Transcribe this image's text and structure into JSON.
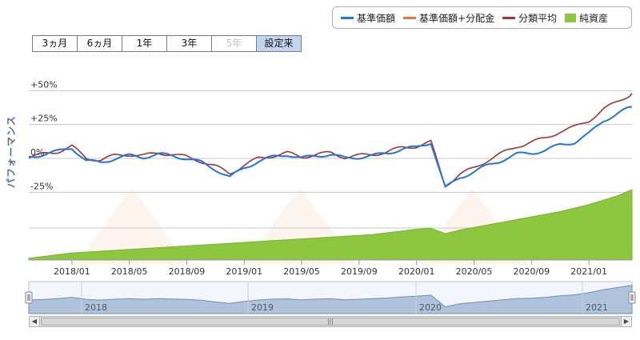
{
  "legend": {
    "items": [
      {
        "label": "基準価額",
        "color": "#1f77e0"
      },
      {
        "label": "基準価額+分配金",
        "color": "#e8734a"
      },
      {
        "label": "分類平均",
        "color": "#a83232"
      },
      {
        "label": "純資産",
        "color": "#8dc63f"
      }
    ]
  },
  "range_buttons": [
    {
      "label": "3ヵ月",
      "state": "normal"
    },
    {
      "label": "6ヵ月",
      "state": "normal"
    },
    {
      "label": "1年",
      "state": "normal"
    },
    {
      "label": "3年",
      "state": "normal"
    },
    {
      "label": "5年",
      "state": "disabled"
    },
    {
      "label": "設定来",
      "state": "active"
    }
  ],
  "chart_data": {
    "type": "line",
    "ylabel": "パフォーマンス",
    "y_ticks": [
      {
        "value": 50,
        "label": "+50%"
      },
      {
        "value": 25,
        "label": "+25%"
      },
      {
        "value": 0,
        "label": "0%"
      },
      {
        "value": -25,
        "label": "-25%"
      }
    ],
    "ylim": [
      -25,
      50
    ],
    "x_ticks": [
      "2018/01",
      "2018/05",
      "2018/09",
      "2019/01",
      "2019/05",
      "2019/09",
      "2020/01",
      "2020/05",
      "2020/09",
      "2021/01"
    ],
    "x": [
      "2017/10",
      "2017/11",
      "2017/12",
      "2018/01",
      "2018/02",
      "2018/03",
      "2018/04",
      "2018/05",
      "2018/06",
      "2018/07",
      "2018/08",
      "2018/09",
      "2018/10",
      "2018/11",
      "2018/12",
      "2019/01",
      "2019/02",
      "2019/03",
      "2019/04",
      "2019/05",
      "2019/06",
      "2019/07",
      "2019/08",
      "2019/09",
      "2019/10",
      "2019/11",
      "2019/12",
      "2020/01",
      "2020/02",
      "2020/03",
      "2020/04",
      "2020/05",
      "2020/06",
      "2020/07",
      "2020/08",
      "2020/09",
      "2020/10",
      "2020/11",
      "2020/12",
      "2021/01",
      "2021/02",
      "2021/03",
      "2021/04"
    ],
    "series": [
      {
        "name": "基準価額",
        "color": "#1f77e0",
        "values": [
          1,
          3,
          5,
          8,
          -2,
          -3,
          0,
          2,
          1,
          3,
          2,
          0,
          -3,
          -8,
          -14,
          -7,
          -2,
          1,
          3,
          0,
          2,
          3,
          0,
          1,
          2,
          4,
          7,
          8,
          12,
          -22,
          -14,
          -10,
          -5,
          -1,
          3,
          4,
          6,
          10,
          12,
          18,
          28,
          33,
          38
        ]
      },
      {
        "name": "基準価額+分配金",
        "color": "#e8734a",
        "values": [
          1,
          3,
          5,
          8,
          -2,
          -3,
          0,
          2,
          1,
          3,
          2,
          0,
          -3,
          -8,
          -14,
          -7,
          -2,
          1,
          3,
          0,
          2,
          3,
          0,
          1,
          2,
          4,
          7,
          8,
          12,
          -22,
          -14,
          -10,
          -5,
          -1,
          3,
          4,
          6,
          10,
          12,
          18,
          28,
          33,
          38
        ]
      },
      {
        "name": "分類平均",
        "color": "#a83232",
        "values": [
          1,
          3,
          5,
          9,
          0,
          -1,
          2,
          3,
          2,
          4,
          3,
          1,
          -2,
          -6,
          -11,
          -5,
          0,
          2,
          4,
          1,
          3,
          4,
          1,
          2,
          3,
          5,
          8,
          9,
          12,
          -20,
          -12,
          -7,
          -1,
          4,
          9,
          12,
          15,
          20,
          23,
          28,
          36,
          42,
          48
        ]
      }
    ],
    "area_series": {
      "name": "純資産",
      "color": "#8dc63f",
      "values": [
        2,
        4,
        6,
        8,
        9,
        10,
        11,
        12,
        13,
        14,
        15,
        16,
        17,
        18,
        19,
        20,
        21,
        22,
        23,
        24,
        25,
        26,
        27,
        28,
        29,
        31,
        33,
        35,
        36,
        30,
        34,
        37,
        40,
        43,
        46,
        49,
        52,
        55,
        59,
        63,
        68,
        73,
        80
      ]
    },
    "navigator": {
      "labels": [
        "2018",
        "2019",
        "2020",
        "2021"
      ],
      "values": [
        2,
        3,
        5,
        8,
        4,
        3,
        5,
        6,
        5,
        6,
        5,
        4,
        2,
        -2,
        -5,
        -1,
        2,
        4,
        5,
        3,
        5,
        6,
        4,
        5,
        6,
        7,
        9,
        10,
        12,
        -12,
        -6,
        -3,
        0,
        3,
        6,
        7,
        9,
        12,
        14,
        18,
        24,
        28,
        32
      ]
    },
    "grid": true,
    "legend_position": "top-right"
  }
}
